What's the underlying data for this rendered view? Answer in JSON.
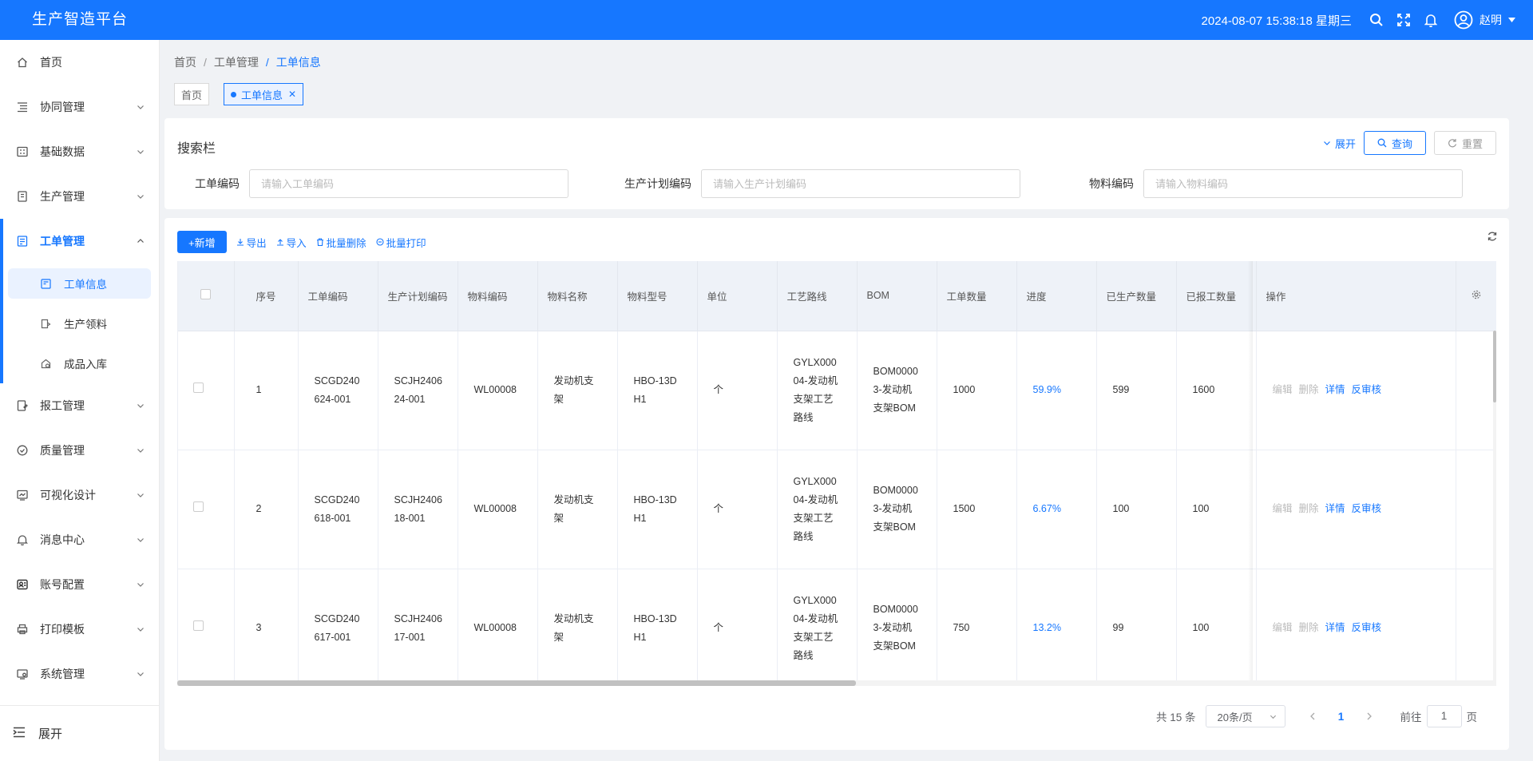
{
  "header": {
    "title": "生产智造平台",
    "datetime": "2024-08-07 15:38:18 星期三",
    "user_name": "赵明"
  },
  "sidebar": {
    "items": [
      {
        "label": "首页",
        "icon": "home-icon"
      },
      {
        "label": "协同管理",
        "icon": "list-icon"
      },
      {
        "label": "基础数据",
        "icon": "grid-icon"
      },
      {
        "label": "生产管理",
        "icon": "doc-icon"
      },
      {
        "label": "工单管理",
        "icon": "form-icon"
      },
      {
        "label": "报工管理",
        "icon": "report-icon"
      },
      {
        "label": "质量管理",
        "icon": "check-circle-icon"
      },
      {
        "label": "可视化设计",
        "icon": "chart-icon"
      },
      {
        "label": "消息中心",
        "icon": "bell-icon"
      },
      {
        "label": "账号配置",
        "icon": "account-icon"
      },
      {
        "label": "打印模板",
        "icon": "printer-icon"
      },
      {
        "label": "系统管理",
        "icon": "settings-icon"
      }
    ],
    "sub_items": [
      {
        "label": "工单信息"
      },
      {
        "label": "生产领料"
      },
      {
        "label": "成品入库"
      }
    ],
    "collapse_label": "展开"
  },
  "breadcrumb": {
    "items": [
      "首页",
      "工单管理",
      "工单信息"
    ]
  },
  "tags": {
    "home": "首页",
    "active": "工单信息"
  },
  "search": {
    "title": "搜索栏",
    "expand": "展开",
    "query": "查询",
    "reset": "重置",
    "fields": [
      {
        "label": "工单编码",
        "placeholder": "请输入工单编码"
      },
      {
        "label": "生产计划编码",
        "placeholder": "请输入生产计划编码"
      },
      {
        "label": "物料编码",
        "placeholder": "请输入物料编码"
      }
    ]
  },
  "toolbar": {
    "add": "+新增",
    "export": "导出",
    "import": "导入",
    "batch_delete": "批量删除",
    "batch_print": "批量打印"
  },
  "table": {
    "headers": [
      "序号",
      "工单编码",
      "生产计划编码",
      "物料编码",
      "物料名称",
      "物料型号",
      "单位",
      "工艺路线",
      "BOM",
      "工单数量",
      "进度",
      "已生产数量",
      "已报工数量",
      "操作"
    ],
    "ops": {
      "edit": "编辑",
      "delete": "删除",
      "detail": "详情",
      "unaudit": "反审核"
    },
    "rows": [
      {
        "no": "1",
        "wo_code": "SCGD240624-001",
        "plan_code": "SCJH240624-001",
        "mat_code": "WL00008",
        "mat_name": "发动机支架",
        "mat_model": "HBO-13DH1",
        "unit": "个",
        "route": "GYLX00004-发动机支架工艺路线",
        "bom": "BOM00003-发动机支架BOM",
        "qty": "1000",
        "progress": "59.9%",
        "produced": "599",
        "reported": "1600"
      },
      {
        "no": "2",
        "wo_code": "SCGD240618-001",
        "plan_code": "SCJH240618-001",
        "mat_code": "WL00008",
        "mat_name": "发动机支架",
        "mat_model": "HBO-13DH1",
        "unit": "个",
        "route": "GYLX00004-发动机支架工艺路线",
        "bom": "BOM00003-发动机支架BOM",
        "qty": "1500",
        "progress": "6.67%",
        "produced": "100",
        "reported": "100"
      },
      {
        "no": "3",
        "wo_code": "SCGD240617-001",
        "plan_code": "SCJH240617-001",
        "mat_code": "WL00008",
        "mat_name": "发动机支架",
        "mat_model": "HBO-13DH1",
        "unit": "个",
        "route": "GYLX00004-发动机支架工艺路线",
        "bom": "BOM00003-发动机支架BOM",
        "qty": "750",
        "progress": "13.2%",
        "produced": "99",
        "reported": "100"
      }
    ]
  },
  "pagination": {
    "total": "共 15 条",
    "page_size": "20条/页",
    "current": "1",
    "goto_label": "前往",
    "goto_value": "1",
    "page_suffix": "页"
  },
  "colors": {
    "primary": "#1677ff",
    "header_bg": "#1677ff"
  }
}
